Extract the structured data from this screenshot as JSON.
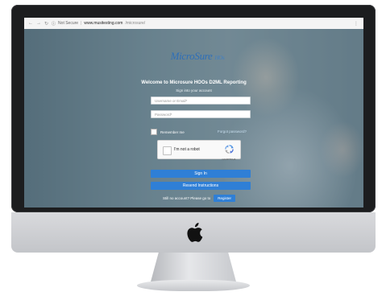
{
  "browser": {
    "secure_label": "Not Secure",
    "separator": "|",
    "domain": "www.musitesting.com",
    "path": "/microsure/"
  },
  "login": {
    "logo_text": "MicroSure",
    "logo_sub": "HOs",
    "welcome": "Welcome to Microsure HOOs D2ML Reporting",
    "subtitle": "Sign into your account",
    "username_placeholder": "Username or Email*",
    "password_placeholder": "Password*",
    "remember_label": "Remember me",
    "forgot_label": "Forgot password?",
    "captcha_label": "I'm not a robot",
    "captcha_badge": "reCAPTCHA",
    "sign_in": "Sign In",
    "resend": "Resend Instructions",
    "register_prompt": "Still no account? Please go to",
    "register": "Register"
  },
  "colors": {
    "brand": "#2e6fb8",
    "button": "#2f7fd6",
    "bezel": "#1c1d1f"
  },
  "icons": [
    "back-icon",
    "forward-icon",
    "reload-icon",
    "info-icon",
    "menu-dots-icon",
    "apple-logo-icon",
    "recaptcha-icon"
  ]
}
